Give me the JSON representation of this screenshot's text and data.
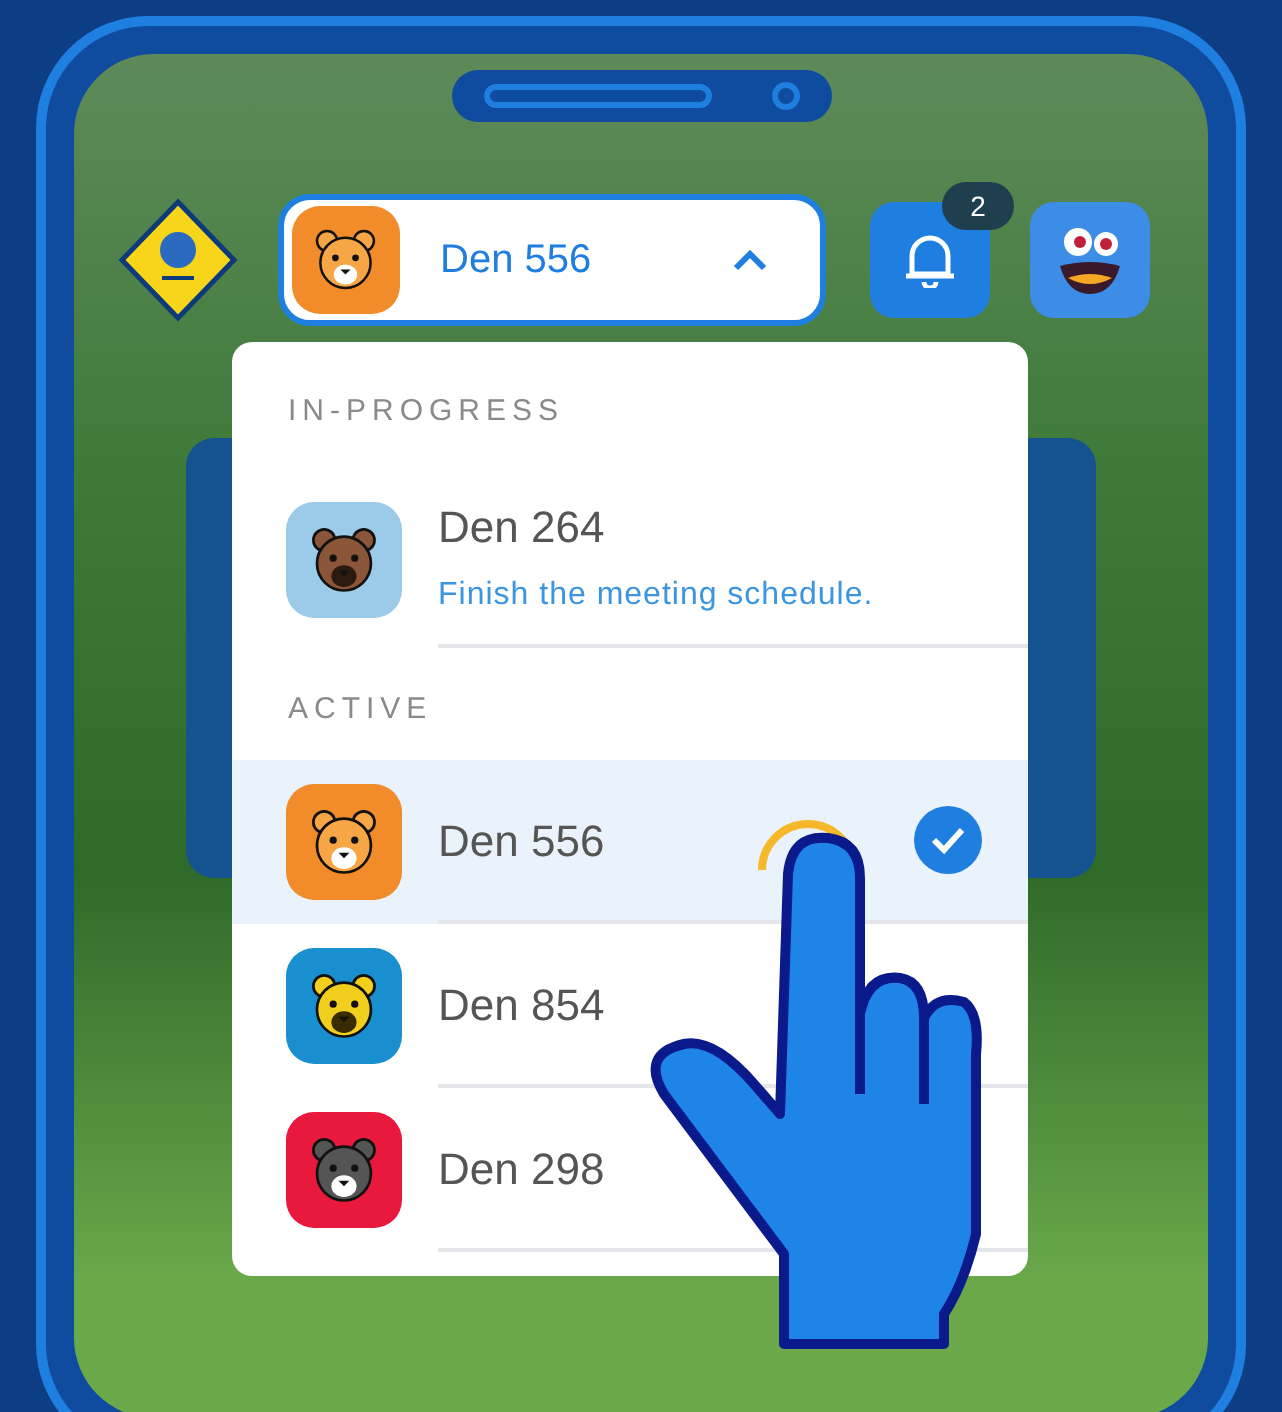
{
  "den_selector": {
    "name": "Den 556",
    "kind": "tiger",
    "color": "#f28b2a",
    "expanded": true
  },
  "notifications": {
    "count": "2"
  },
  "menu": [
    {
      "title": "IN-PROGRESS",
      "items": [
        {
          "name": "Den 264",
          "subtitle": "Finish the meeting schedule.",
          "kind": "bear",
          "color": "#9ccbe9",
          "selected": false
        }
      ]
    },
    {
      "title": "ACTIVE",
      "items": [
        {
          "name": "Den 556",
          "kind": "tiger",
          "color": "#f28b2a",
          "selected": true
        },
        {
          "name": "Den 854",
          "kind": "bobcat",
          "color": "#1a8fd0",
          "selected": false
        },
        {
          "name": "Den 298",
          "kind": "wolf",
          "color": "#e8193d",
          "selected": false
        }
      ]
    }
  ]
}
